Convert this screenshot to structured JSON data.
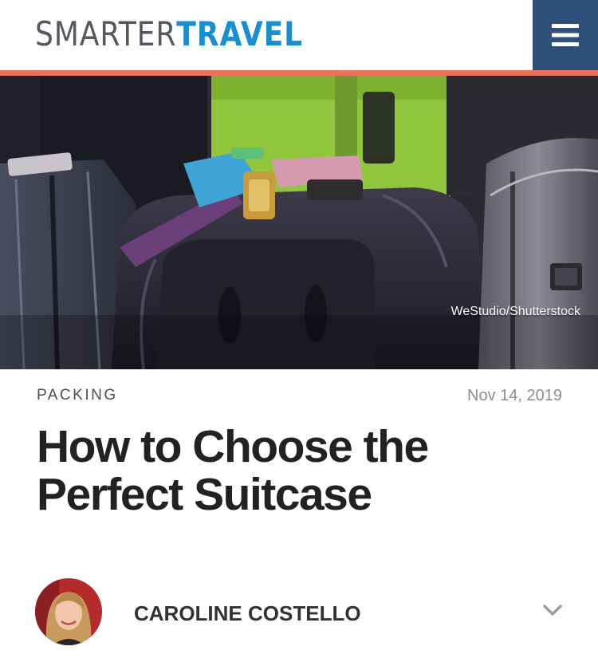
{
  "header": {
    "logo_part1": "SMARTER",
    "logo_part2": "TRAVEL",
    "menu_icon": "hamburger-menu-icon"
  },
  "hero": {
    "photo_credit": "WeStudio/Shutterstock"
  },
  "article": {
    "category": "PACKING",
    "date": "Nov 14, 2019",
    "title": "How to Choose the Perfect Suitcase"
  },
  "author": {
    "name": "CAROLINE COSTELLO",
    "expand_icon": "chevron-down-icon"
  },
  "colors": {
    "logo_gray": "#54595f",
    "logo_blue": "#1a8fcf",
    "menu_bg": "#2f4f7b",
    "accent_rule": "#e8735a",
    "title_text": "#222222"
  }
}
